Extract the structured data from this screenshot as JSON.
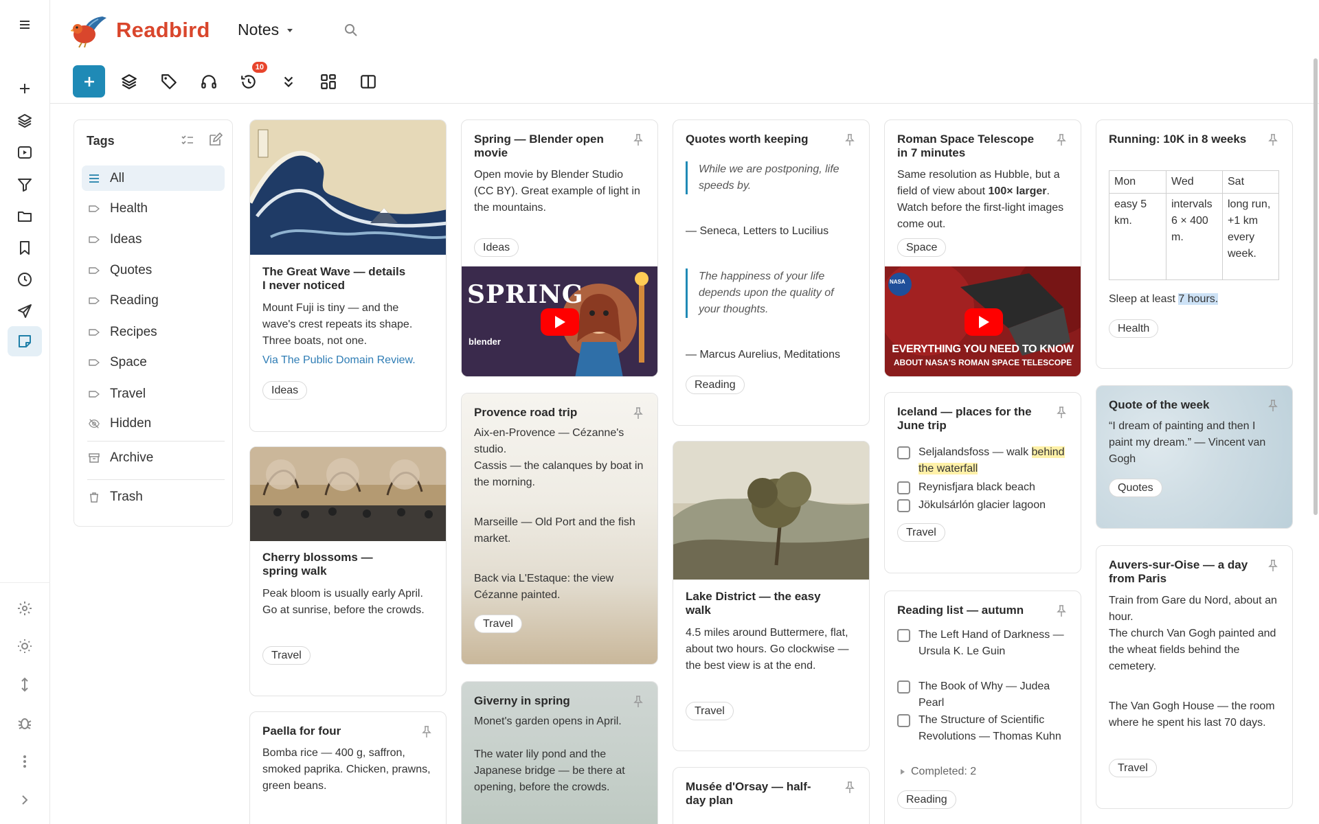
{
  "app": {
    "name": "Readbird"
  },
  "header": {
    "view_title": "Notes"
  },
  "toolbar": {
    "history_badge": "10"
  },
  "tags_panel": {
    "title": "Tags",
    "items": [
      {
        "label": "All",
        "icon": "list-icon"
      },
      {
        "label": "Health",
        "icon": "tag-icon"
      },
      {
        "label": "Ideas",
        "icon": "tag-icon"
      },
      {
        "label": "Quotes",
        "icon": "tag-icon"
      },
      {
        "label": "Reading",
        "icon": "tag-icon"
      },
      {
        "label": "Recipes",
        "icon": "tag-icon"
      },
      {
        "label": "Space",
        "icon": "tag-icon"
      },
      {
        "label": "Travel",
        "icon": "tag-icon"
      },
      {
        "label": "Hidden",
        "icon": "eye-off-icon"
      }
    ],
    "archive": "Archive",
    "trash": "Trash"
  },
  "cards": {
    "great_wave": {
      "title": "The Great Wave — details I never noticed",
      "body": "Mount Fuji is tiny — and the wave's crest repeats its shape. Three boats, not one.",
      "link": "Via The Public Domain Review.",
      "tag": "Ideas"
    },
    "cherry": {
      "title": "Cherry blossoms — spring walk",
      "body": "Peak bloom is usually early April. Go at sunrise, before the crowds.",
      "tag": "Travel"
    },
    "paella": {
      "title": "Paella for four",
      "body": "Bomba rice — 400 g, saffron, smoked paprika. Chicken, prawns, green beans."
    },
    "spring": {
      "title": "Spring — Blender open movie",
      "body": "Open movie by Blender Studio (CC BY). Great example of light in the mountains.",
      "tag": "Ideas",
      "video_title": "SPRING",
      "video_brand": "blender"
    },
    "provence": {
      "title": "Provence road trip",
      "p1": "Aix-en-Provence — Cézanne's studio.",
      "p2": "Cassis — the calanques by boat in the morning.",
      "p3": "Marseille — Old Port and the fish market.",
      "p4": "Back via L'Estaque: the view Cézanne painted.",
      "tag": "Travel"
    },
    "giverny": {
      "title": "Giverny in spring",
      "p1": "Monet's garden opens in April.",
      "p2": "The water lily pond and the Japanese bridge — be there at opening, before the crowds."
    },
    "quotes": {
      "title": "Quotes worth keeping",
      "q1": "While we are postponing, life speeds by.",
      "a1": "— Seneca, Letters to Lucilius",
      "q2": "The happiness of your life depends upon the quality of your thoughts.",
      "a2": "— Marcus Aurelius, Meditations",
      "tag": "Reading"
    },
    "lake": {
      "title": "Lake District — the easy walk",
      "body": "4.5 miles around Buttermere, flat, about two hours. Go clockwise — the best view is at the end.",
      "tag": "Travel"
    },
    "orsay": {
      "title": "Musée d'Orsay — half-day plan"
    },
    "roman": {
      "title": "Roman Space Telescope in 7 minutes",
      "body_pre": "Same resolution as Hubble, but a field of view about ",
      "body_bold": "100× larger",
      "body_post": ". Watch before the first-light images come out.",
      "tag": "Space",
      "video_line1": "EVERYTHING YOU NEED TO KNOW",
      "video_line2": "ABOUT NASA'S ROMAN SPACE TELESCOPE",
      "video_brand": "NASA"
    },
    "iceland": {
      "title": "Iceland — places for the June trip",
      "items": [
        {
          "pre": "Seljalandsfoss — walk ",
          "hl": "behind the waterfall"
        },
        {
          "pre": "Reynisfjara black beach",
          "hl": ""
        },
        {
          "pre": "Jökulsárlón glacier lagoon",
          "hl": ""
        }
      ],
      "tag": "Travel"
    },
    "reading": {
      "title": "Reading list — autumn",
      "items": [
        "The Left Hand of Darkness — Ursula K. Le Guin",
        "The Book of Why — Judea Pearl",
        "The Structure of Scientific Revolutions — Thomas Kuhn"
      ],
      "completed": "Completed: 2",
      "tag": "Reading"
    },
    "running": {
      "title": "Running: 10K in 8 weeks",
      "table_head": [
        "Mon",
        "Wed",
        "Sat"
      ],
      "table_row": [
        "easy 5 km.",
        "intervals 6 × 400 m.",
        "long run, +1 km every week."
      ],
      "note_pre": "Sleep at least ",
      "note_sel": "7 hours.",
      "tag": "Health"
    },
    "qotw": {
      "title": "Quote of the week",
      "body": "“I dream of painting and then I paint my dream.” — Vincent van Gogh",
      "tag": "Quotes"
    },
    "auvers": {
      "title": "Auvers-sur-Oise — a day from Paris",
      "p1": "Train from Gare du Nord, about an hour.",
      "p2": "The church Van Gogh painted and the wheat fields behind the cemetery.",
      "p3": "The Van Gogh House — the room where he spent his last 70 days.",
      "tag": "Travel"
    }
  },
  "colors": {
    "accent": "#1f8ab6",
    "brand": "#d9462c",
    "badge": "#e8452c"
  }
}
